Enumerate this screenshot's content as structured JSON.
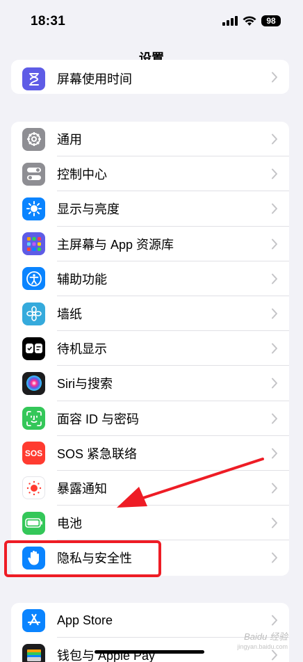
{
  "status_bar": {
    "time": "18:31",
    "battery_level": "98"
  },
  "nav": {
    "title": "设置"
  },
  "top_group": {
    "items": [
      {
        "label": "屏幕使用时间",
        "icon": "hourglass-icon",
        "color": "#5e5ce6"
      }
    ]
  },
  "general_group": {
    "items": [
      {
        "label": "通用",
        "icon": "gear-icon",
        "color": "#8e8e93"
      },
      {
        "label": "控制中心",
        "icon": "toggles-icon",
        "color": "#8e8e93"
      },
      {
        "label": "显示与亮度",
        "icon": "sun-icon",
        "color": "#0a84ff"
      },
      {
        "label": "主屏幕与 App 资源库",
        "icon": "app-grid-icon",
        "color": "#5e5ce6"
      },
      {
        "label": "辅助功能",
        "icon": "accessibility-icon",
        "color": "#0a84ff"
      },
      {
        "label": "墙纸",
        "icon": "flower-icon",
        "color": "#35aadc"
      },
      {
        "label": "待机显示",
        "icon": "standby-icon",
        "color": "#000000"
      },
      {
        "label": "Siri与搜索",
        "icon": "siri-icon",
        "color": "#1c1c1e"
      },
      {
        "label": "面容 ID 与密码",
        "icon": "face-id-icon",
        "color": "#34c759"
      },
      {
        "label": "SOS 紧急联络",
        "icon": "sos-icon",
        "color": "#ff3b30",
        "icon_text": "SOS"
      },
      {
        "label": "暴露通知",
        "icon": "exposure-icon",
        "color": "#ffffff"
      },
      {
        "label": "电池",
        "icon": "battery-icon",
        "color": "#34c759"
      },
      {
        "label": "隐私与安全性",
        "icon": "hand-icon",
        "color": "#0a84ff"
      }
    ]
  },
  "store_group": {
    "items": [
      {
        "label": "App Store",
        "icon": "app-store-icon",
        "color": "#0a84ff"
      },
      {
        "label": "钱包与 Apple Pay",
        "icon": "wallet-icon",
        "color": "#1c1c1e"
      }
    ]
  },
  "annotation": {
    "highlight_color": "#ee1c25"
  },
  "watermark": {
    "text": "Baidu 经验",
    "sub": "jingyan.baidu.com"
  }
}
